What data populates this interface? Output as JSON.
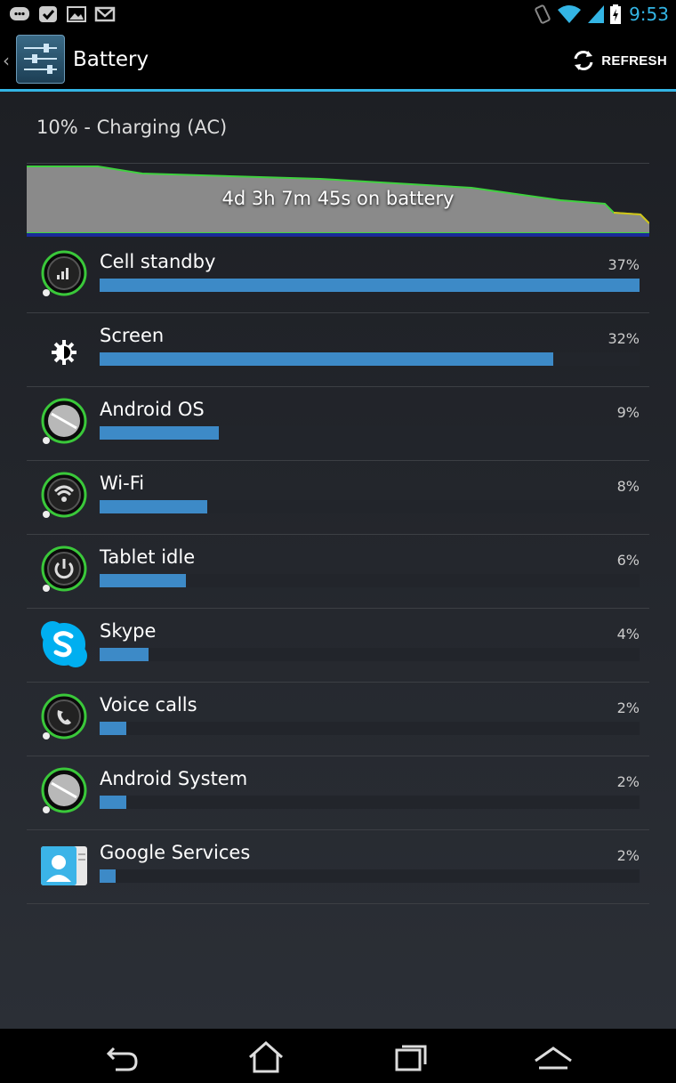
{
  "status_bar": {
    "time": "9:53",
    "icons": [
      "message-icon",
      "check-icon",
      "image-icon",
      "gmail-icon",
      "vibrate-icon",
      "wifi-icon",
      "signal-icon",
      "battery-charging-icon"
    ]
  },
  "action_bar": {
    "title": "Battery",
    "refresh_label": "REFRESH"
  },
  "summary": {
    "status": "10% - Charging (AC)"
  },
  "graph": {
    "label": "4d 3h 7m 45s on battery"
  },
  "usage": {
    "items": [
      {
        "label": "Cell standby",
        "percent": "37%",
        "fill": 1.0,
        "icon": "cell-signal-icon"
      },
      {
        "label": "Screen",
        "percent": "32%",
        "fill": 0.84,
        "icon": "brightness-icon"
      },
      {
        "label": "Android OS",
        "percent": "9%",
        "fill": 0.22,
        "icon": "android-os-icon"
      },
      {
        "label": "Wi-Fi",
        "percent": "8%",
        "fill": 0.2,
        "icon": "wifi-icon"
      },
      {
        "label": "Tablet idle",
        "percent": "6%",
        "fill": 0.16,
        "icon": "power-icon"
      },
      {
        "label": "Skype",
        "percent": "4%",
        "fill": 0.09,
        "icon": "skype-icon"
      },
      {
        "label": "Voice calls",
        "percent": "2%",
        "fill": 0.05,
        "icon": "phone-icon"
      },
      {
        "label": "Android System",
        "percent": "2%",
        "fill": 0.05,
        "icon": "android-system-icon"
      },
      {
        "label": "Google Services",
        "percent": "2%",
        "fill": 0.03,
        "icon": "contact-card-icon"
      }
    ]
  },
  "nav": {
    "buttons": [
      "back-icon",
      "home-icon",
      "recent-apps-icon",
      "menu-up-icon"
    ]
  },
  "colors": {
    "accent": "#33b5e5",
    "bar": "#3d8ac7",
    "graph_line": "#3fd13f"
  }
}
